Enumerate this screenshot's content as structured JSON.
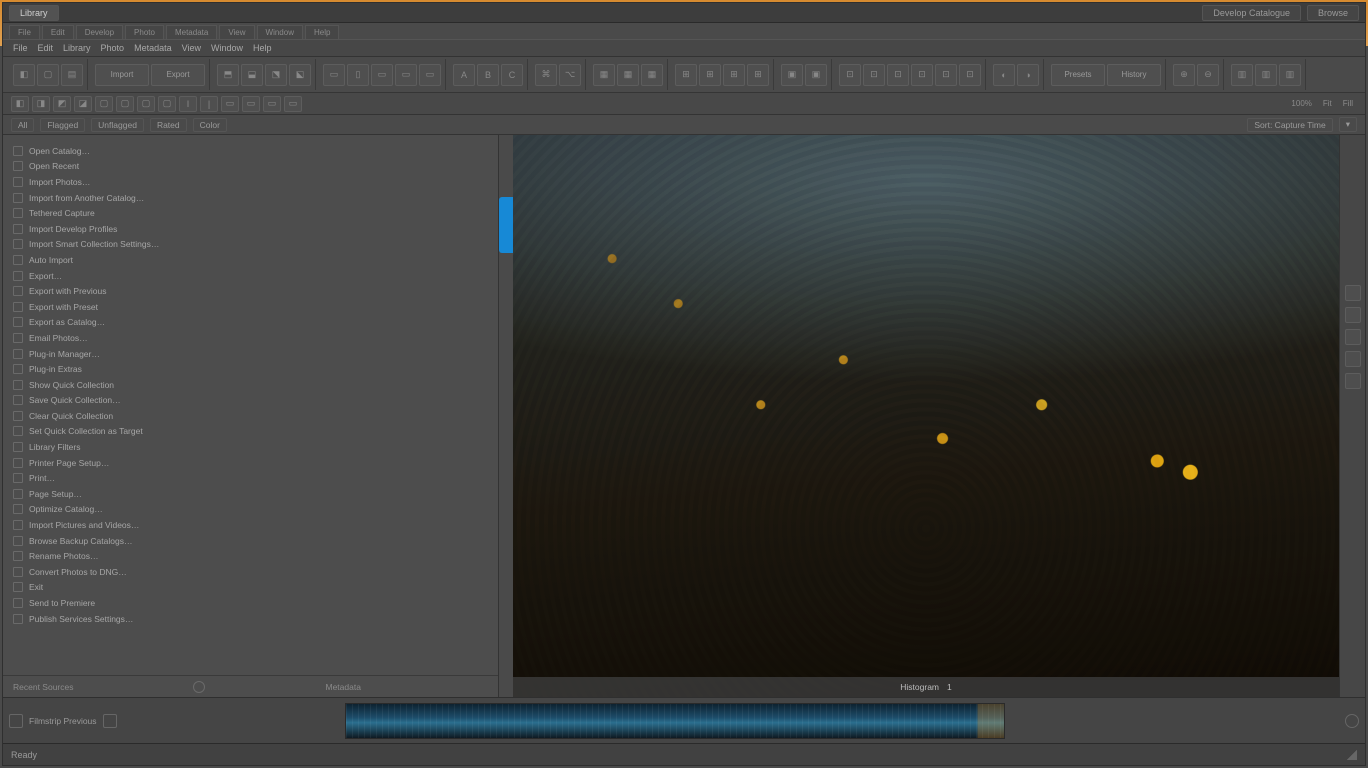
{
  "title_tabs": {
    "left": {
      "label": "Library"
    },
    "right": [
      {
        "label": "Develop Catalogue"
      },
      {
        "label": "Browse"
      }
    ]
  },
  "sys_tabs": [
    "File",
    "Edit",
    "Develop",
    "Photo",
    "Metadata",
    "View",
    "Window",
    "Help"
  ],
  "menubar": [
    "File",
    "Edit",
    "Library",
    "Photo",
    "Metadata",
    "View",
    "Window",
    "Help"
  ],
  "ribbonA_groups": [
    [
      "◧",
      "▢",
      "▤"
    ],
    [
      "Import",
      "Export"
    ],
    [
      "⬒",
      "⬓",
      "⬔",
      "⬕"
    ],
    [
      "▭",
      "▯",
      "▭",
      "▭",
      "▭"
    ],
    [
      "A",
      "B",
      "C"
    ],
    [
      "⌘",
      "⌥"
    ],
    [
      "▦",
      "▦",
      "▦"
    ],
    [
      "⊞",
      "⊞",
      "⊞",
      "⊞"
    ],
    [
      "▣",
      "▣"
    ],
    [
      "⊡",
      "⊡",
      "⊡",
      "⊡",
      "⊡",
      "⊡"
    ],
    [
      "◐",
      "◑"
    ],
    [
      "Presets",
      "History"
    ],
    [
      "⊕",
      "⊖"
    ],
    [
      "▥",
      "▥",
      "▥"
    ]
  ],
  "ribbonB": {
    "left": [
      "◧",
      "◨",
      "◩",
      "◪",
      "▢",
      "▢",
      "▢",
      "▢",
      "I",
      "|",
      "▭",
      "▭",
      "▭",
      "▭"
    ],
    "right_labels": [
      "100%",
      "Fit",
      "Fill"
    ]
  },
  "filterbar": {
    "left": [
      "All",
      "Flagged",
      "Unflagged",
      "Rated",
      "Color"
    ],
    "right": [
      "Sort: Capture Time",
      "▾"
    ]
  },
  "sidebar": {
    "items": [
      "Open Catalog…",
      "Open Recent",
      "Import Photos…",
      "Import from Another Catalog…",
      "Tethered Capture",
      "Import Develop Profiles",
      "Import Smart Collection Settings…",
      "Auto Import",
      "Export…",
      "Export with Previous",
      "Export with Preset",
      "Export as Catalog…",
      "Email Photos…",
      "Plug-in Manager…",
      "Plug-in Extras",
      "Show Quick Collection",
      "Save Quick Collection…",
      "Clear Quick Collection",
      "Set Quick Collection as Target",
      "Library Filters",
      "Printer Page Setup…",
      "Print…",
      "Page Setup…",
      "Optimize Catalog…",
      "Import Pictures and Videos…",
      "Browse Backup Catalogs…",
      "Rename Photos…",
      "Convert Photos to DNG…",
      "Exit",
      "Send to Premiere",
      "Publish Services Settings…"
    ],
    "footer_left": "Recent Sources",
    "footer_mid_icon": "history-icon",
    "footer_right": "Metadata"
  },
  "preview": {
    "footer_label": "Histogram",
    "footer_count": "1"
  },
  "rail_tools": [
    "crop",
    "brush",
    "grad",
    "radial",
    "spot"
  ],
  "filmstrip": {
    "ctrl_label": "Filmstrip  Previous"
  },
  "status": {
    "left": "Ready"
  },
  "colors": {
    "accent": "#1789d6"
  }
}
